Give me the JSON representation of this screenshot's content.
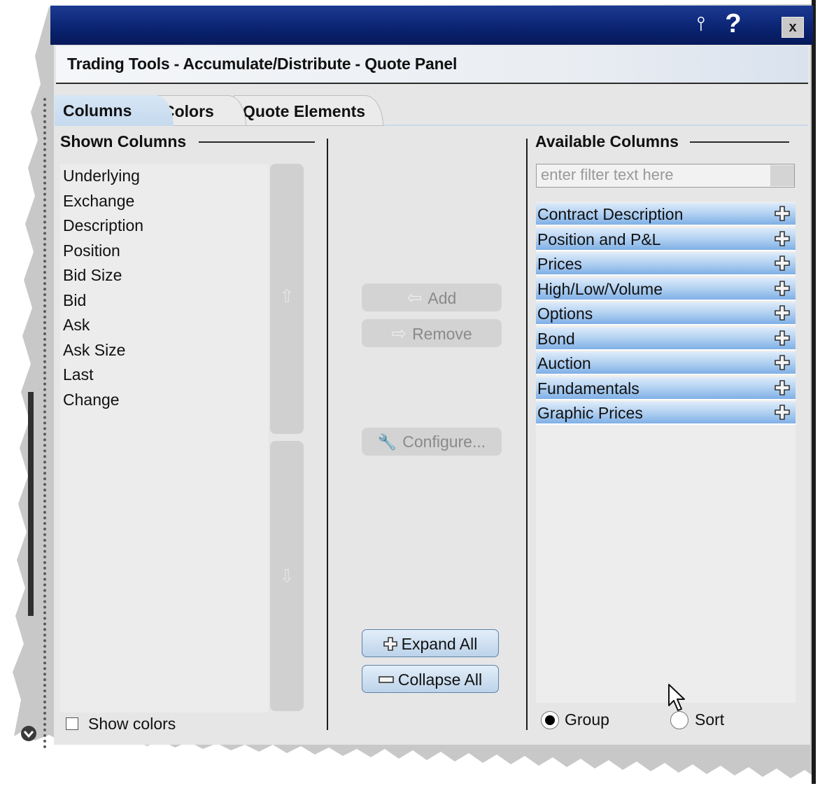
{
  "window": {
    "panel_title": "Trading Tools - Accumulate/Distribute - Quote Panel",
    "pin_icon": "pin-icon",
    "help_label": "?",
    "close_label": "x"
  },
  "tabs": [
    {
      "label": "Columns",
      "active": true
    },
    {
      "label": "Colors",
      "active": false
    },
    {
      "label": "Quote Elements",
      "active": false
    }
  ],
  "shown": {
    "header": "Shown Columns",
    "items": [
      "Underlying",
      "Exchange",
      "Description",
      "Position",
      "Bid Size",
      "Bid",
      "Ask",
      "Ask Size",
      "Last",
      "Change"
    ],
    "show_colors_label": "Show colors",
    "show_colors_checked": false
  },
  "actions": {
    "add": "Add",
    "remove": "Remove",
    "configure": "Configure...",
    "expand_all": "Expand All",
    "collapse_all": "Collapse All"
  },
  "available": {
    "header": "Available Columns",
    "filter_placeholder": "enter filter text here",
    "groups": [
      "Contract Description",
      "Position and P&L",
      "Prices",
      "High/Low/Volume",
      "Options",
      "Bond",
      "Auction",
      "Fundamentals",
      "Graphic Prices"
    ],
    "group_label": "Group",
    "sort_label": "Sort",
    "selected_mode": "Group"
  },
  "colors": {
    "titlebar": "#0a2370",
    "row_highlight": "#7fb0e6",
    "panel_bg": "#e6e6e6"
  }
}
